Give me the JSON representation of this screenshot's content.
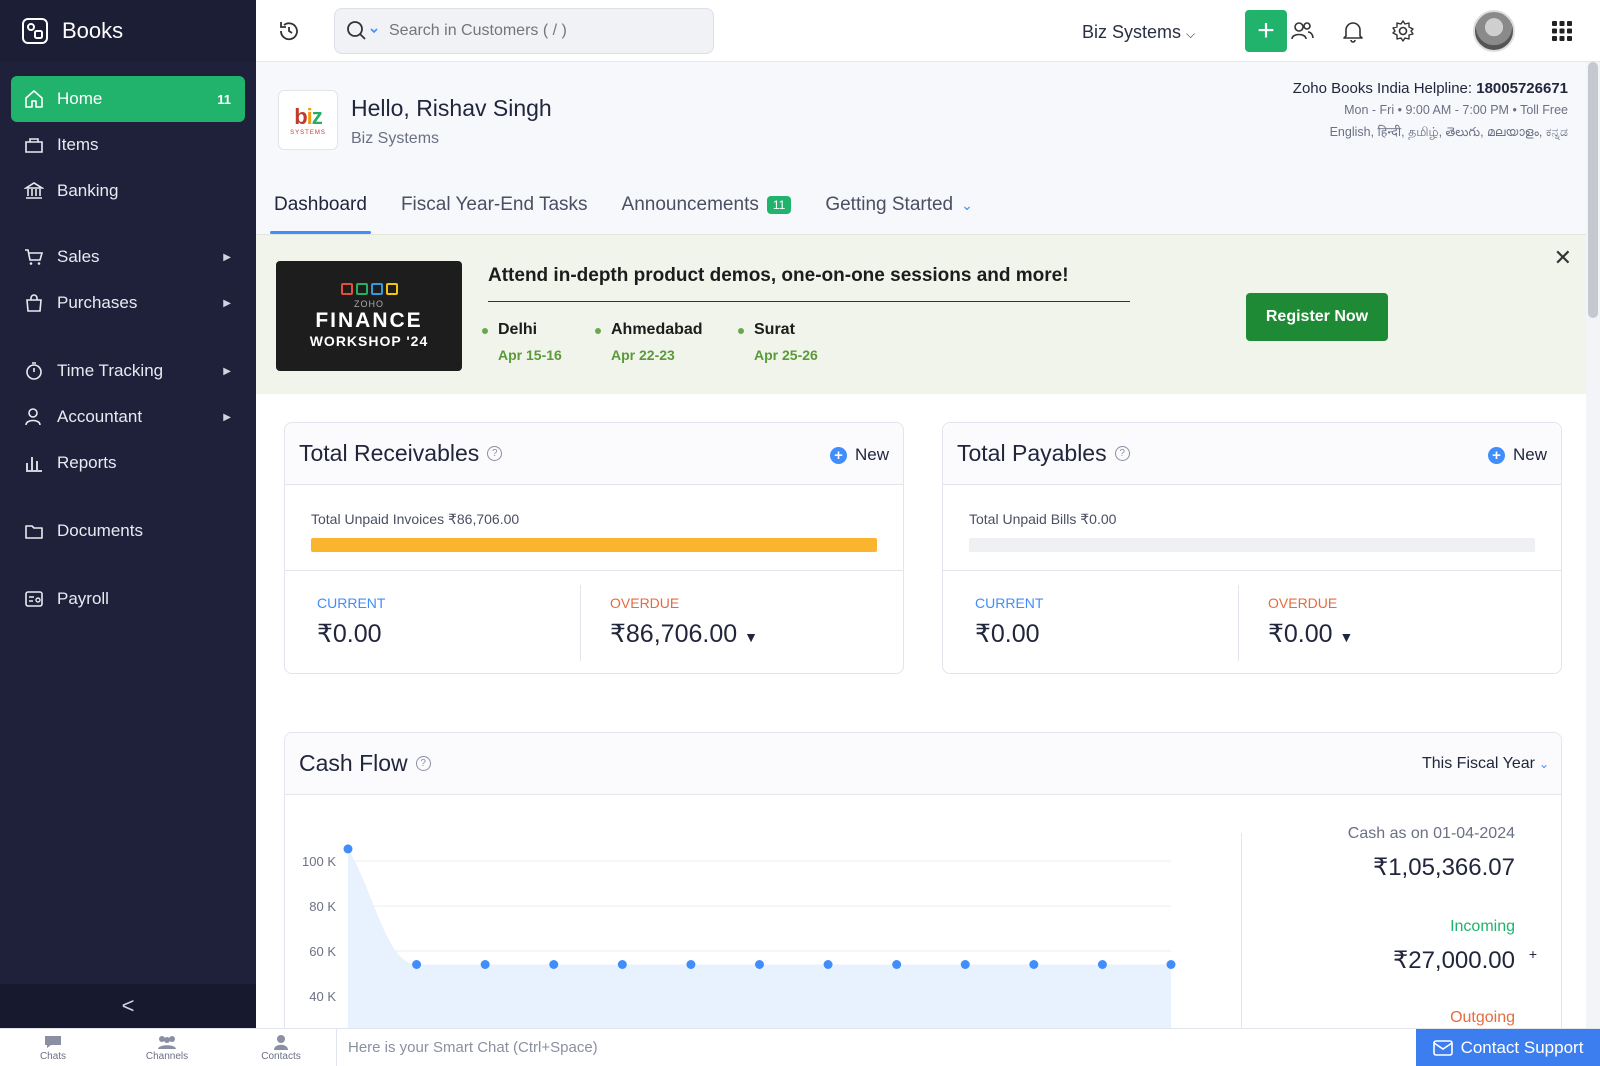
{
  "app": {
    "name": "Books"
  },
  "sidebar": {
    "items": [
      {
        "label": "Home",
        "badge": "11"
      },
      {
        "label": "Items"
      },
      {
        "label": "Banking"
      },
      {
        "label": "Sales"
      },
      {
        "label": "Purchases"
      },
      {
        "label": "Time Tracking"
      },
      {
        "label": "Accountant"
      },
      {
        "label": "Reports"
      },
      {
        "label": "Documents"
      },
      {
        "label": "Payroll"
      }
    ],
    "collapse_glyph": "<"
  },
  "topbar": {
    "search_placeholder": "Search in Customers ( / )",
    "org_name": "Biz Systems",
    "plus_glyph": "+"
  },
  "header": {
    "greeting": "Hello, Rishav Singh",
    "org": "Biz Systems",
    "logo_text": "biz",
    "logo_sub": "SYSTEMS",
    "helpline_label": "Zoho Books India Helpline:",
    "helpline_number": "18005726671",
    "helpline_hours": "Mon - Fri • 9:00 AM - 7:00 PM • Toll Free",
    "helpline_languages": "English, हिन्दी, தமிழ், తెలుగు, മലയാളം, ಕನ್ನಡ"
  },
  "tabs": [
    {
      "label": "Dashboard"
    },
    {
      "label": "Fiscal Year-End Tasks"
    },
    {
      "label": "Announcements",
      "badge": "11"
    },
    {
      "label": "Getting Started"
    }
  ],
  "banner": {
    "workshop_brand": "ZOHO",
    "workshop_title": "FINANCE",
    "workshop_subtitle": "WORKSHOP '24",
    "headline": "Attend in-depth product demos, one-on-one sessions and more!",
    "cities": [
      {
        "name": "Delhi",
        "date": "Apr 15-16"
      },
      {
        "name": "Ahmedabad",
        "date": "Apr 22-23"
      },
      {
        "name": "Surat",
        "date": "Apr 25-26"
      }
    ],
    "register_label": "Register Now",
    "close_glyph": "✕"
  },
  "receivables": {
    "title": "Total Receivables",
    "new_label": "New",
    "unpaid_label": "Total Unpaid Invoices ₹86,706.00",
    "progress_fraction": 1.0,
    "current_label": "CURRENT",
    "current_value": "₹0.00",
    "overdue_label": "OVERDUE",
    "overdue_value": "₹86,706.00"
  },
  "payables": {
    "title": "Total Payables",
    "new_label": "New",
    "unpaid_label": "Total Unpaid Bills ₹0.00",
    "progress_fraction": 0.0,
    "current_label": "CURRENT",
    "current_value": "₹0.00",
    "overdue_label": "OVERDUE",
    "overdue_value": "₹0.00"
  },
  "cashflow": {
    "title": "Cash Flow",
    "period": "This Fiscal Year",
    "cash_as_on": "Cash as on 01-04-2024",
    "cash_value": "₹1,05,366.07",
    "incoming_label": "Incoming",
    "incoming_value": "₹27,000.00",
    "incoming_sign": "+",
    "outgoing_label": "Outgoing"
  },
  "chart_data": {
    "type": "area",
    "y_ticks": [
      "100 K",
      "80 K",
      "60 K",
      "40 K"
    ],
    "ylim": [
      40000,
      100000
    ],
    "values": [
      105366.07,
      54000,
      54000,
      54000,
      54000,
      54000,
      54000,
      54000,
      54000,
      54000,
      54000,
      54000,
      54000
    ],
    "line_color": "#408dfb",
    "fill_color": "#e8f2fe",
    "grid": true
  },
  "bottombar": {
    "items": [
      {
        "label": "Chats"
      },
      {
        "label": "Channels"
      },
      {
        "label": "Contacts"
      }
    ],
    "smartchat_placeholder": "Here is your Smart Chat (Ctrl+Space)",
    "support_label": "Contact Support"
  },
  "colors": {
    "sidebar_bg": "#1e2139",
    "accent_green": "#21b36b",
    "accent_blue": "#408dfb",
    "bar_orange": "#fbb42d",
    "overdue_orange": "#e56c3e",
    "register_green": "#1e8a35"
  }
}
